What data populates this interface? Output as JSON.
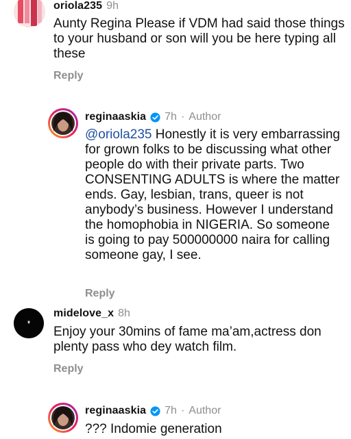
{
  "comments": [
    {
      "username": "oriola235",
      "time": "9h",
      "text": "Aunty Regina Please if VDM had said those things to your husband or son will you be here typing all these",
      "reply_label": "Reply"
    },
    {
      "username": "reginaaskia",
      "time": "7h",
      "author_label": "Author",
      "mention": "@oriola235",
      "text": " Honestly it is very embarrassing for grown folks to be discussing what other people do with their private parts. Two CONSENTING ADULTS is where the matter ends. Gay, lesbian, trans, queer is not anybody’s business. However I understand the homophobia in NIGERIA. So someone is going to pay 500000000 naira for calling someone gay, I see.",
      "reply_label": "Reply"
    },
    {
      "username": "midelove_x",
      "time": "8h",
      "text": "Enjoy your 30mins of fame ma’am,actress don plenty pass who dey watch film.",
      "reply_label": "Reply"
    },
    {
      "username": "reginaaskia",
      "time": "7h",
      "author_label": "Author",
      "text": "??? Indomie generation"
    }
  ],
  "separator": "·"
}
